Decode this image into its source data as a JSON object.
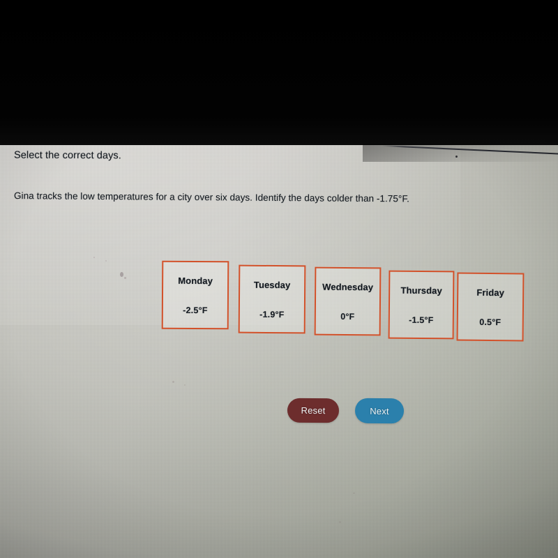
{
  "screen": {
    "prompt_title": "Select the correct days.",
    "prompt_body": "Gina tracks the low temperatures for a city over six days. Identify the days colder than -1.75°F."
  },
  "cards": [
    {
      "day": "Monday",
      "temperature": "-2.5°F"
    },
    {
      "day": "Tuesday",
      "temperature": "-1.9°F"
    },
    {
      "day": "Wednesday",
      "temperature": "0°F"
    },
    {
      "day": "Thursday",
      "temperature": "-1.5°F"
    },
    {
      "day": "Friday",
      "temperature": "0.5°F"
    }
  ],
  "buttons": {
    "reset_label": "Reset",
    "next_label": "Next"
  },
  "colors": {
    "card_border": "#d2512a",
    "reset_button": "#6d2d2d",
    "next_button": "#2b80ac",
    "text": "#141a20",
    "screen_background": "#c6c6bf",
    "top_band": "#000000"
  }
}
